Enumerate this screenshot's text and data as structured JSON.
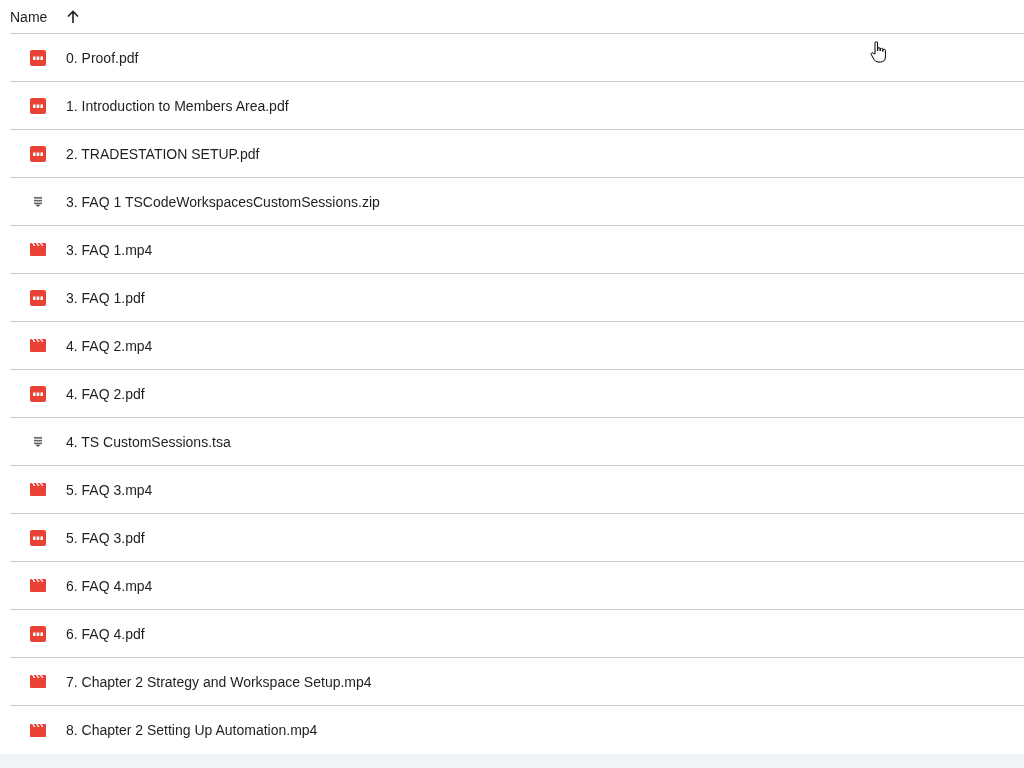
{
  "header": {
    "label": "Name",
    "sort_ascending": true
  },
  "files": [
    {
      "name": "0. Proof.pdf",
      "kind": "pdf"
    },
    {
      "name": "1. Introduction to Members Area.pdf",
      "kind": "pdf"
    },
    {
      "name": "2. TRADESTATION SETUP.pdf",
      "kind": "pdf"
    },
    {
      "name": "3. FAQ 1 TSCodeWorkspacesCustomSessions.zip",
      "kind": "archive"
    },
    {
      "name": "3. FAQ 1.mp4",
      "kind": "video"
    },
    {
      "name": "3. FAQ 1.pdf",
      "kind": "pdf"
    },
    {
      "name": "4. FAQ 2.mp4",
      "kind": "video"
    },
    {
      "name": "4. FAQ 2.pdf",
      "kind": "pdf"
    },
    {
      "name": "4. TS CustomSessions.tsa",
      "kind": "archive"
    },
    {
      "name": "5. FAQ 3.mp4",
      "kind": "video"
    },
    {
      "name": "5. FAQ 3.pdf",
      "kind": "pdf"
    },
    {
      "name": "6. FAQ 4.mp4",
      "kind": "video"
    },
    {
      "name": "6. FAQ 4.pdf",
      "kind": "pdf"
    },
    {
      "name": "7. Chapter 2 Strategy and Workspace Setup.mp4",
      "kind": "video"
    },
    {
      "name": "8. Chapter 2 Setting Up Automation.mp4",
      "kind": "video"
    }
  ]
}
